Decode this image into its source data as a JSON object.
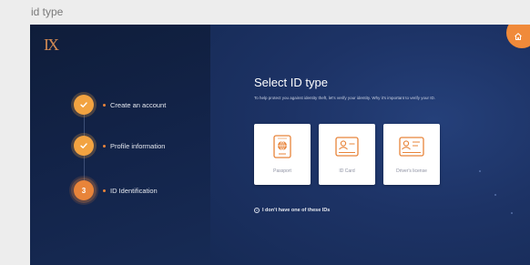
{
  "frame_label": "id type",
  "logo_text": "IX",
  "steps": [
    {
      "label": "Create an account",
      "status": "done",
      "marker": "✓"
    },
    {
      "label": "Profile information",
      "status": "done",
      "marker": "✓"
    },
    {
      "label": "ID Identification",
      "status": "current",
      "marker": "3"
    }
  ],
  "main": {
    "title": "Select ID type",
    "subtitle": "To help protect you against identity theft, let's verify your identity. Why it's important to verify your ID.",
    "cards": [
      {
        "label": "Passport",
        "icon": "passport-icon"
      },
      {
        "label": "ID Card",
        "icon": "id-card-icon"
      },
      {
        "label": "Driver's license",
        "icon": "drivers-license-icon"
      }
    ],
    "no_id_label": "I don't have one of these IDs"
  },
  "colors": {
    "accent": "#e8843a",
    "left_panel": "#13244a",
    "right_panel": "#1d3366"
  }
}
